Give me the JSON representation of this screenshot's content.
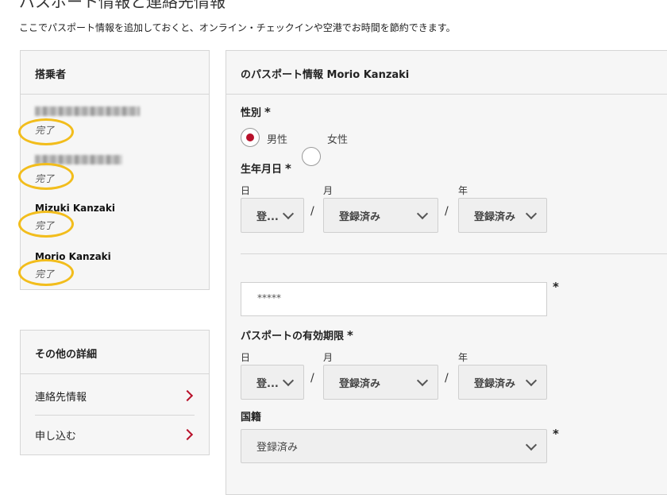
{
  "page": {
    "title": "パスポート情報と連絡先情報",
    "subtitle": "ここでパスポート情報を追加しておくと、オンライン・チェックインや空港でお時間を節約できます。"
  },
  "passengers_panel": {
    "heading": "搭乗者",
    "passengers": [
      {
        "name": "",
        "status": "完了"
      },
      {
        "name": "",
        "status": "完了"
      },
      {
        "name": "Mizuki Kanzaki",
        "status": "完了"
      },
      {
        "name": "Morio Kanzaki",
        "status": "完了"
      }
    ]
  },
  "other_panel": {
    "heading": "その他の詳細",
    "items": [
      {
        "label": "連絡先情報",
        "icon": "chevron-right-icon"
      },
      {
        "label": "申し込む",
        "icon": "chevron-right-icon"
      }
    ]
  },
  "form": {
    "heading": "のパスポート情報 Morio Kanzaki",
    "gender": {
      "label": "性別",
      "required": "*",
      "options": [
        {
          "label": "男性",
          "selected": true
        },
        {
          "label": "女性",
          "selected": false
        }
      ]
    },
    "birth_date": {
      "label": "生年月日",
      "required": "*",
      "day_label": "日",
      "day_value": "登...",
      "month_label": "月",
      "month_value": "登録済み",
      "year_label": "年",
      "year_value": "登録済み",
      "separator": "/"
    },
    "passport_number": {
      "value": "*****",
      "required": "*"
    },
    "expiry": {
      "label": "パスポートの有効期限",
      "required": "*",
      "day_label": "日",
      "day_value": "登...",
      "month_label": "月",
      "month_value": "登録済み",
      "year_label": "年",
      "year_value": "登録済み",
      "separator": "/"
    },
    "nationality": {
      "label": "国籍",
      "value": "登録済み",
      "required": "*"
    }
  },
  "colors": {
    "accent": "#b8102a",
    "highlight_circle": "#f2bd1c",
    "panel_bg": "#f6f6f6",
    "border": "#d6d6d6"
  }
}
